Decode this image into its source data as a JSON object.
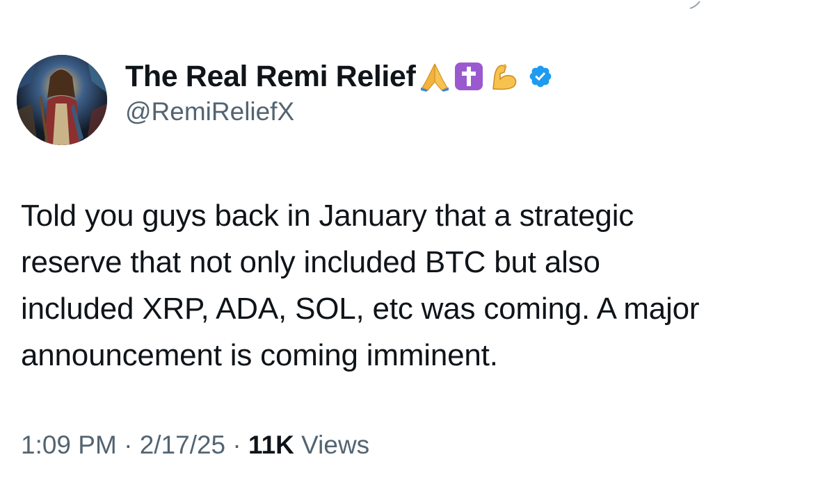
{
  "author": {
    "display_name": "The Real Remi Relief",
    "emojis": [
      "praying-hands",
      "latin-cross",
      "flexed-biceps"
    ],
    "verified": true,
    "handle": "@RemiReliefX"
  },
  "tweet": {
    "lines": [
      "Told you guys back in January that a strategic",
      "reserve that not only included BTC but also",
      "included XRP, ADA, SOL, etc was coming. A major",
      "announcement is coming imminent."
    ]
  },
  "meta": {
    "time": "1:09 PM",
    "separator": "·",
    "date": "2/17/25",
    "views_count": "11K",
    "views_label": "Views"
  },
  "colors": {
    "primary_text": "#0f1419",
    "secondary_text": "#536471",
    "verified_blue": "#1d9bf0",
    "cross_purple": "#9b59d0"
  }
}
